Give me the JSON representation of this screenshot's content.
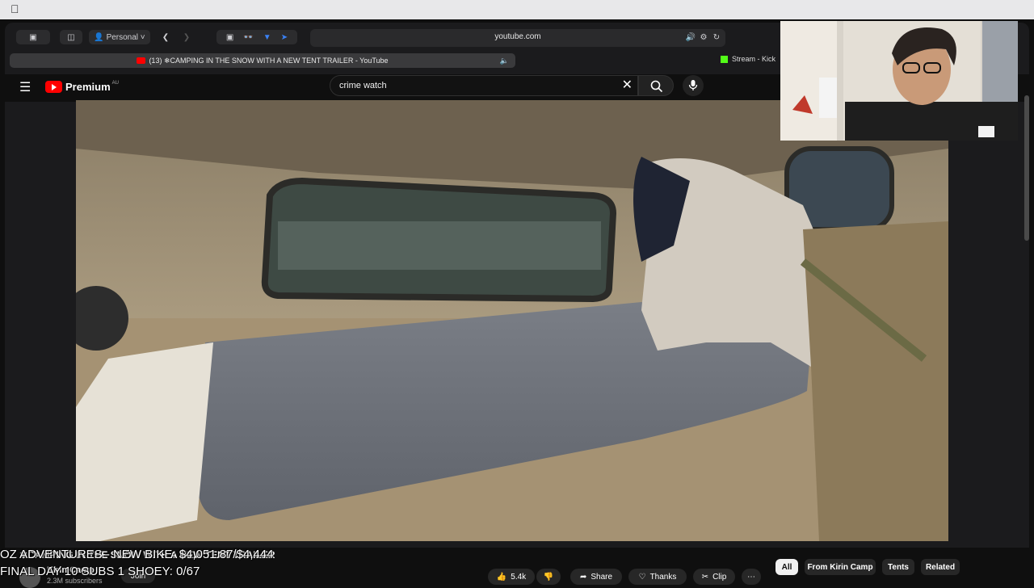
{
  "browser": {
    "profile_label": "Personal",
    "url": "youtube.com",
    "active_tab_title": "(13) ❄CAMPING IN THE SNOW WITH A NEW TENT TRAILER - YouTube",
    "second_tab_title": "Stream - Kick"
  },
  "youtube": {
    "logo_text": "Premium",
    "region": "AU",
    "search_value": "crime watch"
  },
  "video": {
    "title": "❄CAMPING IN THE SNOW WITH A NEW TENT TRAILER",
    "channel_name": "Kirin Camp",
    "subscribers": "2.3M subscribers",
    "join_label": "Join",
    "likes": "5.4k",
    "share_label": "Share",
    "thanks_label": "Thanks",
    "clip_label": "Clip"
  },
  "chips": [
    "All",
    "From Kirin Camp",
    "Tents",
    "Related"
  ],
  "overlay": {
    "line1": "OZ ADVENTURES - NEW BIKE: $4,051.87/$4,444",
    "line2": "FINAL DAY 10 SUBS 1 SHOEY: 0/67"
  },
  "colors": {
    "youtube_red": "#ff0000",
    "kick_green": "#53fc18",
    "background": "#0f0f0f"
  }
}
